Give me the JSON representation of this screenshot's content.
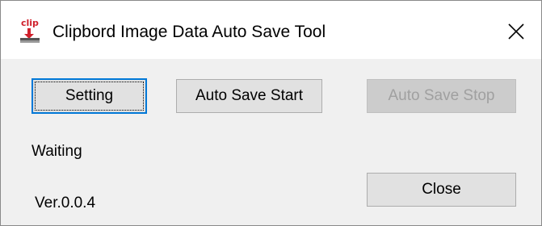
{
  "window": {
    "title": "Clipbord Image Data Auto Save Tool",
    "icon": "clip-app-icon",
    "icon_text": "clip",
    "close_icon": "close-icon"
  },
  "buttons": {
    "setting_label": "Setting",
    "auto_save_start_label": "Auto Save Start",
    "auto_save_stop_label": "Auto Save Stop",
    "close_label": "Close"
  },
  "states": {
    "setting_focused": true,
    "auto_save_stop_enabled": false
  },
  "status": {
    "text": "Waiting"
  },
  "version": {
    "text": "Ver.0.0.4"
  },
  "colors": {
    "focus_border": "#0078d7",
    "window_background": "#f0f0f0",
    "titlebar_background": "#ffffff",
    "icon_red": "#d0202c"
  }
}
